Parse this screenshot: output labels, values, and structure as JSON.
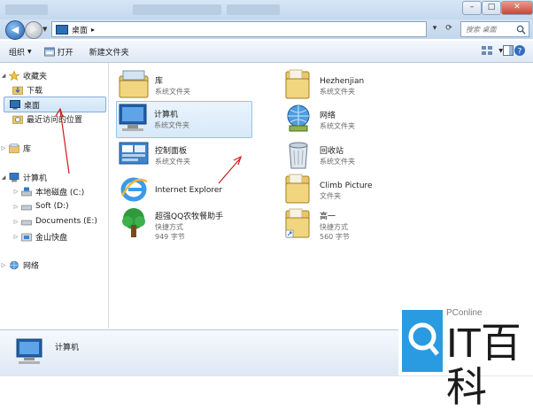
{
  "window": {
    "controls": {
      "minimize": "–",
      "maximize": "□",
      "close": "✕"
    }
  },
  "address_bar": {
    "location": "桌面",
    "separator": "▸"
  },
  "search": {
    "placeholder": "搜索 桌面"
  },
  "toolbar": {
    "organize": "组织",
    "open": "打开",
    "new_folder": "新建文件夹"
  },
  "sidebar": {
    "favorites": "收藏夹",
    "downloads": "下载",
    "desktop": "桌面",
    "recent": "最近访问的位置",
    "libraries": "库",
    "computer": "计算机",
    "local_disk": "本地磁盘 (C:)",
    "soft": "Soft (D:)",
    "documents": "Documents (E:)",
    "jinshan": "金山快盘",
    "network": "网络"
  },
  "items": {
    "libraries": {
      "name": "库",
      "sub": "系统文件夹"
    },
    "computer": {
      "name": "计算机",
      "sub": "系统文件夹"
    },
    "control_panel": {
      "name": "控制面板",
      "sub": "系统文件夹"
    },
    "ie": {
      "name": "Internet Explorer"
    },
    "qq": {
      "name": "超强QQ农牧餐助手",
      "sub": "快捷方式",
      "size": "949 字节"
    },
    "hezhenjian": {
      "name": "Hezhenjian",
      "sub": "系统文件夹"
    },
    "network": {
      "name": "网络",
      "sub": "系统文件夹"
    },
    "recycle": {
      "name": "回收站",
      "sub": "系统文件夹"
    },
    "climb": {
      "name": "Climb Picture",
      "sub": "文件夹"
    },
    "gaoyi": {
      "name": "高一",
      "sub": "快捷方式",
      "size": "560 字节"
    }
  },
  "details": {
    "label": "计算机"
  },
  "watermark": {
    "brand": "PConline",
    "text": "IT百科"
  },
  "colors": {
    "accent": "#2a6fb8",
    "selection": "#cfe4f7",
    "arrow": "#d11a1a"
  }
}
